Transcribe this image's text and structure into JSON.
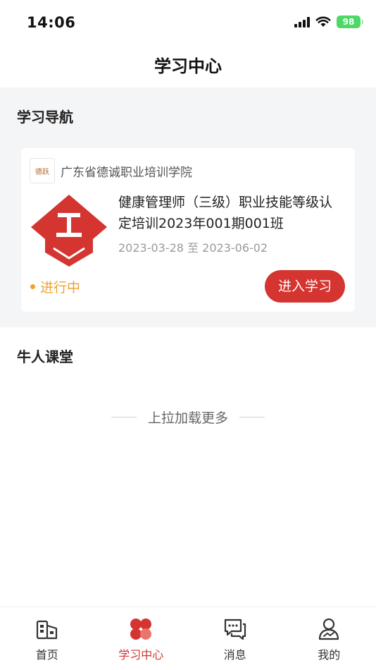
{
  "status_bar": {
    "time": "14:06",
    "battery": "98"
  },
  "header": {
    "title": "学习中心"
  },
  "study_nav": {
    "title": "学习导航",
    "card": {
      "org_logo_text": "德跃",
      "org_name": "广东省德诚职业培训学院",
      "course_title": "健康管理师（三级）职业技能等级认定培训2023年001期001班",
      "dates": "2023-03-28 至 2023-06-02",
      "status": "进行中",
      "enter_label": "进入学习"
    }
  },
  "classroom": {
    "title": "牛人课堂"
  },
  "load_more": "上拉加载更多",
  "tabs": [
    {
      "label": "首页",
      "icon": "home-building-icon"
    },
    {
      "label": "学习中心",
      "icon": "clover-icon",
      "active": true
    },
    {
      "label": "消息",
      "icon": "chat-bubbles-icon"
    },
    {
      "label": "我的",
      "icon": "user-profile-icon"
    }
  ],
  "colors": {
    "accent": "#d43530",
    "status": "#f0a030",
    "section_bg": "#f4f5f7"
  }
}
